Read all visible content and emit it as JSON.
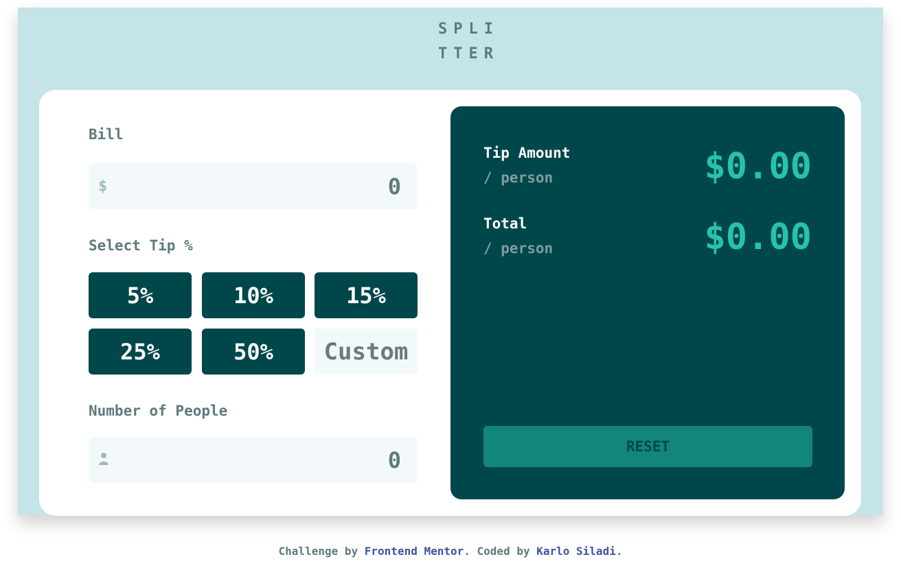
{
  "header": {
    "logo_line1": "SPLI",
    "logo_line2": "TTER"
  },
  "form": {
    "bill_label": "Bill",
    "bill_value": "0",
    "bill_icon": "dollar-icon",
    "tip_label": "Select Tip %",
    "tips": [
      "5%",
      "10%",
      "15%",
      "25%",
      "50%"
    ],
    "custom_placeholder": "Custom",
    "people_label": "Number of People",
    "people_value": "0",
    "people_icon": "person-icon"
  },
  "results": {
    "tip_title": "Tip Amount",
    "tip_sub": "/ person",
    "tip_value": "$0.00",
    "total_title": "Total",
    "total_sub": "/ person",
    "total_value": "$0.00",
    "reset_label": "RESET"
  },
  "footer": {
    "prefix": "Challenge by ",
    "link1": "Frontend Mentor",
    "middle": ". Coded by ",
    "link2": "Karlo Siladi",
    "suffix": "."
  },
  "colors": {
    "background": "#c5e4e7",
    "dark_cyan": "#00474b",
    "strong_cyan": "#26c2ae",
    "text_grey": "#5e7a7d"
  }
}
